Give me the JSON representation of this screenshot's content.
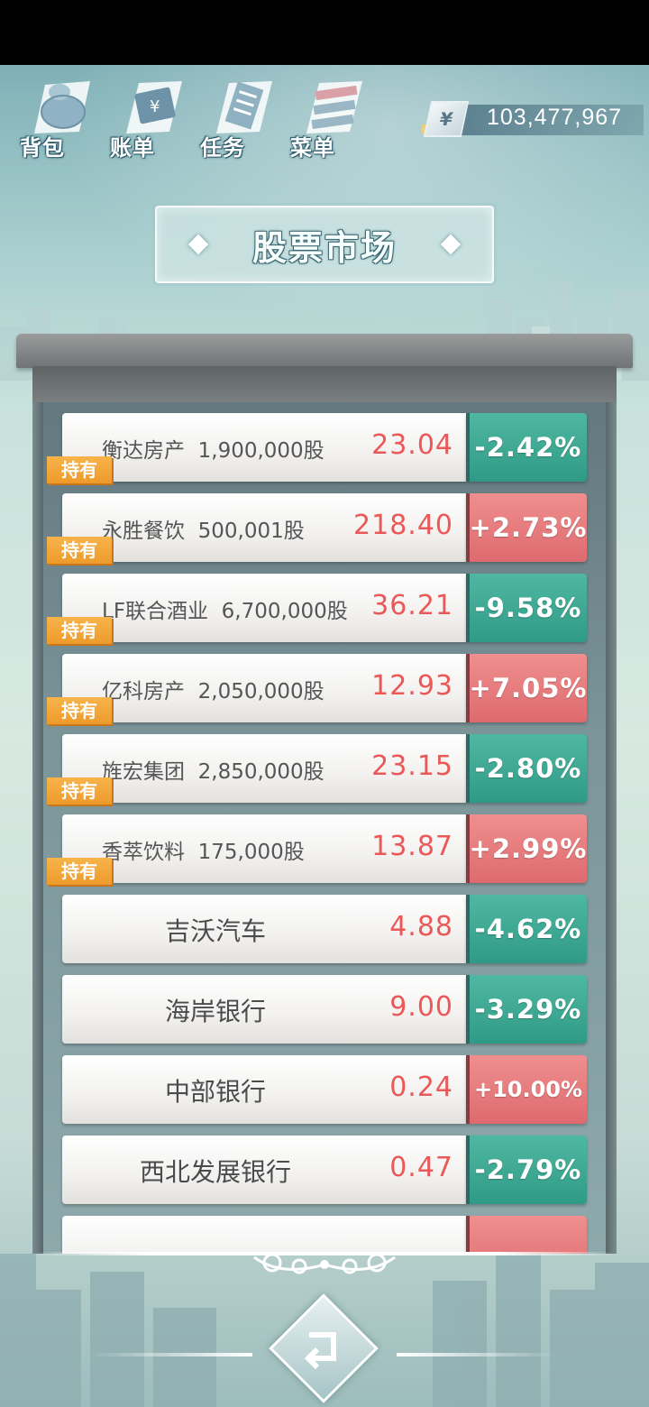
{
  "toolbar": {
    "items": [
      {
        "label": "背包",
        "icon": "backpack-icon"
      },
      {
        "label": "账单",
        "icon": "bill-icon"
      },
      {
        "label": "任务",
        "icon": "task-icon"
      },
      {
        "label": "菜单",
        "icon": "menu-icon"
      }
    ]
  },
  "money": {
    "symbol": "¥",
    "amount": "103,477,967"
  },
  "title": "股票市场",
  "held_label": "持有",
  "colors": {
    "up": "#de6a6e",
    "down": "#2f9a86",
    "price": "#ea5858",
    "held_tag": "#ee9a2c"
  },
  "stocks": [
    {
      "name": "衡达房产",
      "shares": "1,900,000股",
      "price": "23.04",
      "change": "-2.42%",
      "direction": "down",
      "held": true
    },
    {
      "name": "永胜餐饮",
      "shares": "500,001股",
      "price": "218.40",
      "change": "+2.73%",
      "direction": "up",
      "held": true
    },
    {
      "name": "LF联合酒业",
      "shares": "6,700,000股",
      "price": "36.21",
      "change": "-9.58%",
      "direction": "down",
      "held": true
    },
    {
      "name": "亿科房产",
      "shares": "2,050,000股",
      "price": "12.93",
      "change": "+7.05%",
      "direction": "up",
      "held": true
    },
    {
      "name": "旌宏集团",
      "shares": "2,850,000股",
      "price": "23.15",
      "change": "-2.80%",
      "direction": "down",
      "held": true
    },
    {
      "name": "香萃饮料",
      "shares": "175,000股",
      "price": "13.87",
      "change": "+2.99%",
      "direction": "up",
      "held": true
    },
    {
      "name": "吉沃汽车",
      "shares": "",
      "price": "4.88",
      "change": "-4.62%",
      "direction": "down",
      "held": false
    },
    {
      "name": "海岸银行",
      "shares": "",
      "price": "9.00",
      "change": "-3.29%",
      "direction": "down",
      "held": false
    },
    {
      "name": "中部银行",
      "shares": "",
      "price": "0.24",
      "change": "+10.00%",
      "direction": "up",
      "held": false
    },
    {
      "name": "西北发展银行",
      "shares": "",
      "price": "0.47",
      "change": "-2.79%",
      "direction": "down",
      "held": false
    }
  ],
  "back_button": {
    "icon": "back-arrow-icon"
  }
}
